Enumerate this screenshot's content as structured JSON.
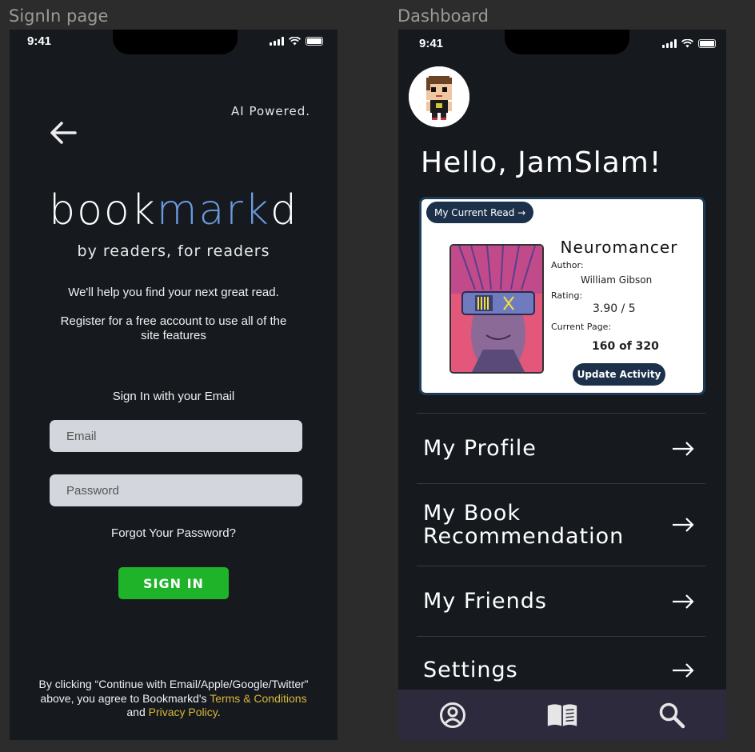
{
  "frames": {
    "signin_label": "SignIn page",
    "dashboard_label": "Dashboard"
  },
  "status_bar": {
    "time": "9:41"
  },
  "signin": {
    "ai_powered": "AI Powered.",
    "logo": {
      "part1": "book",
      "part2": "mark",
      "part3": "d"
    },
    "tagline": "by readers, for readers",
    "intro": "We'll help you find your next great read.",
    "register_line1": "Register for a free account to use all of the",
    "register_line2": "site features",
    "email_heading": "Sign In with your Email",
    "email_placeholder": "Email",
    "password_placeholder": "Password",
    "forgot": "Forgot Your Password?",
    "signin_button": "SIGN IN",
    "legal_line1": "By clicking “Continue with Email/Apple/Google/Twitter”",
    "legal_line2_prefix": "above, you agree to Bookmarkd's ",
    "terms_link": "Terms & Conditions",
    "legal_and": "and ",
    "privacy_link": "Privacy Policy",
    "legal_end": "."
  },
  "dashboard": {
    "greeting": "Hello, JamSlam!",
    "current_read": {
      "pill": "My Current Read →",
      "title": "Neuromancer",
      "author_label": "Author:",
      "author": "William Gibson",
      "rating_label": "Rating:",
      "rating": "3.90 / 5",
      "page_label": "Current Page:",
      "page": "160 of 320",
      "update_button": "Update Activity"
    },
    "menu": [
      {
        "label": "My Profile"
      },
      {
        "label": "My Book Recommendation",
        "line1": "My Book",
        "line2": "Recommendation"
      },
      {
        "label": "My Friends"
      },
      {
        "label": "Settings"
      }
    ],
    "nav": [
      "profile-icon",
      "book-icon",
      "search-icon"
    ]
  },
  "colors": {
    "background": "#161a1f",
    "accent_blue": "#6a9be0",
    "signin_green": "#1fb32a",
    "link_yellow": "#d8b638",
    "navy": "#1c3149",
    "nav_bar": "#2d2a3e"
  }
}
